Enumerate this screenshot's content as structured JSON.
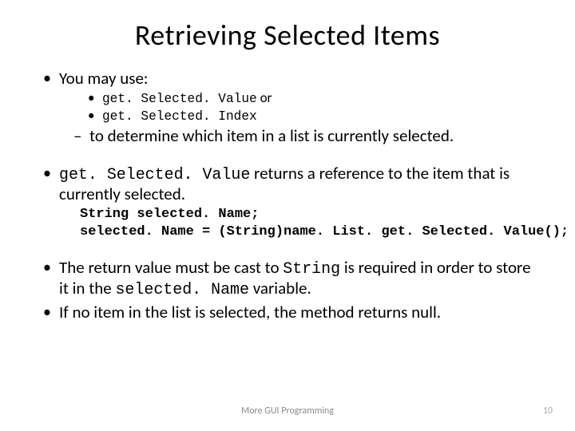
{
  "title": "Retrieving Selected Items",
  "b1": {
    "text": "You may use:",
    "sub1_code": "get. Selected. Value",
    "sub1_tail": " or",
    "sub2_code": "get. Selected. Index",
    "dash": "to determine which item in a list is currently selected."
  },
  "b2": {
    "code": "get. Selected. Value",
    "tail": " returns a reference to the item that is currently selected.",
    "block_line1": "String selected. Name;",
    "block_line2": "selected. Name = (String)name. List. get. Selected. Value();"
  },
  "b3": {
    "pre": "The return value must be cast to ",
    "code1": "String",
    "mid": " is required in order to store it in the ",
    "code2": "selected. Name",
    "post": " variable."
  },
  "b4": "If no item in the list is selected, the method returns null.",
  "footer": "More GUI Programming",
  "pagenum": "10"
}
